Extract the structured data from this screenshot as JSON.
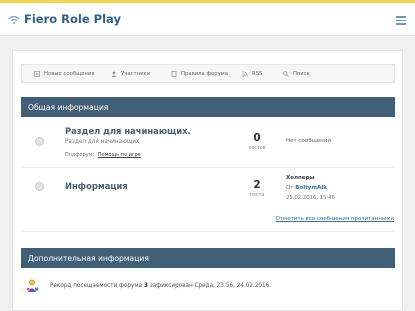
{
  "header": {
    "site_title": "Fiero Role Play"
  },
  "nav": {
    "items": [
      {
        "label": "Новые сообщения",
        "icon": "new-posts-icon"
      },
      {
        "label": "Участники",
        "icon": "members-icon"
      },
      {
        "label": "Правила форума",
        "icon": "rules-icon"
      },
      {
        "label": "RSS",
        "icon": "rss-icon"
      },
      {
        "label": "Поиск",
        "icon": "search-icon"
      }
    ]
  },
  "categories": [
    {
      "title": "Общая информация"
    },
    {
      "title": "Дополнительная информация"
    }
  ],
  "forums": [
    {
      "title": "Раздел для начинающих.",
      "description": "Раздел для начинающих.",
      "subforums_label": "Подфорум:",
      "subforum_link": "Помощь по игре",
      "posts_count": "0",
      "posts_label": "постов",
      "last_post_empty": "Нет сообщений"
    },
    {
      "title": "Информация",
      "posts_count": "2",
      "posts_label": "поста",
      "last_post_title": "Хелперы",
      "last_post_by_label": "От",
      "last_post_author": "BoltymAlk",
      "last_post_date": "25.02.2016, 15:46"
    }
  ],
  "mark_read_link": "Отметить все сообщения прочитанными",
  "stats": {
    "prefix": "Рекорд посещаемости форума",
    "count": "3",
    "suffix": "зафиксирован Среда, 23:56, 24.02.2016."
  },
  "colors": {
    "accent_top": "#f1d650",
    "category_bar": "#425f78",
    "title_blue": "#2f5f86",
    "link_blue": "#3e6f95"
  }
}
